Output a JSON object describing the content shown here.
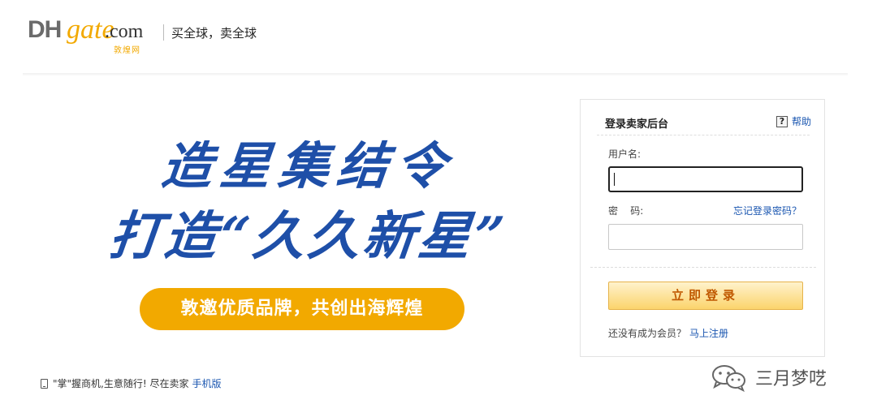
{
  "header": {
    "logo": {
      "dh": "DH",
      "gate": "gate",
      "com": ".com",
      "cn": "敦煌网"
    },
    "slogan": "买全球，卖全球"
  },
  "banner": {
    "line1": "造星集结令",
    "line2": "打造“久久新星”",
    "pill": "敦邀优质品牌，共创出海辉煌",
    "colors": {
      "headline": "#1e4fa8",
      "pill": "#f2a900"
    }
  },
  "login": {
    "title": "登录卖家后台",
    "help_icon": "?",
    "help_label": "帮助",
    "username_label": "用户名:",
    "username_value": "",
    "password_label": "密    码:",
    "password_value": "",
    "forgot_label": "忘记登录密码？",
    "submit_label": "立即登录",
    "register_prompt": "还没有成为会员？",
    "register_link": "马上注册"
  },
  "footer": {
    "mobile_icon": "phone-icon",
    "mobile_text": "\"掌\"握商机,生意随行! 尽在卖家",
    "mobile_link": "手机版"
  },
  "watermark": {
    "icon": "wechat-icon",
    "text": "三月梦呓"
  }
}
